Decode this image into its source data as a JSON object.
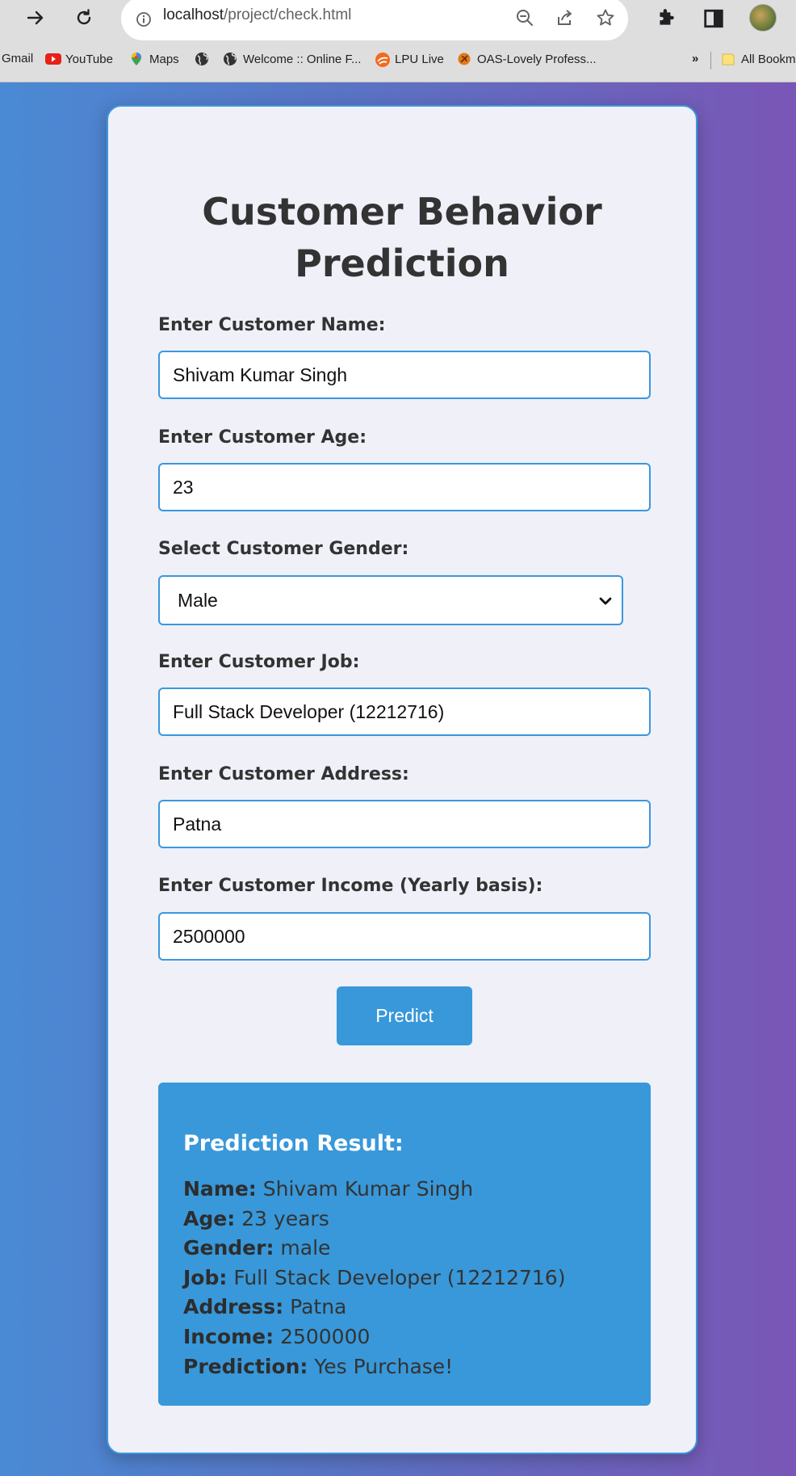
{
  "browser": {
    "url_host": "localhost",
    "url_path": "/project/check.html",
    "bookmarks": [
      "Gmail",
      "YouTube",
      "Maps",
      "Welcome :: Online F...",
      "LPU Live",
      "OAS-Lovely Profess...",
      "All Bookm"
    ],
    "overflow": "»"
  },
  "page": {
    "title_line1": "Customer Behavior",
    "title_line2": "Prediction",
    "name_label": "Enter Customer Name:",
    "name_value": "Shivam Kumar Singh",
    "age_label": "Enter Customer Age:",
    "age_value": "23",
    "gender_label": "Select Customer Gender:",
    "gender_value": "Male",
    "job_label": "Enter Customer Job:",
    "job_value": "Full Stack Developer (12212716)",
    "address_label": "Enter Customer Address:",
    "address_value": "Patna",
    "income_label": "Enter Customer Income (Yearly basis):",
    "income_value": "2500000",
    "predict_button": "Predict"
  },
  "result": {
    "heading": "Prediction Result:",
    "name_key": "Name:",
    "name_val": "Shivam Kumar Singh",
    "age_key": "Age:",
    "age_val": "23 years",
    "gender_key": "Gender:",
    "gender_val": "male",
    "job_key": "Job:",
    "job_val": "Full Stack Developer (12212716)",
    "address_key": "Address:",
    "address_val": "Patna",
    "income_key": "Income:",
    "income_val": "2500000",
    "prediction_key": "Prediction:",
    "prediction_val": "Yes Purchase!"
  },
  "colors": {
    "accent": "#3898da",
    "card_bg": "#eff0f8",
    "gradient_start": "#4a8ad4",
    "gradient_end": "#7a56b6"
  },
  "icons": [
    "forward-icon",
    "reload-icon",
    "info-icon",
    "zoom-out-icon",
    "share-icon",
    "star-icon",
    "extensions-icon",
    "side-panel-icon",
    "chevron-down-icon"
  ]
}
